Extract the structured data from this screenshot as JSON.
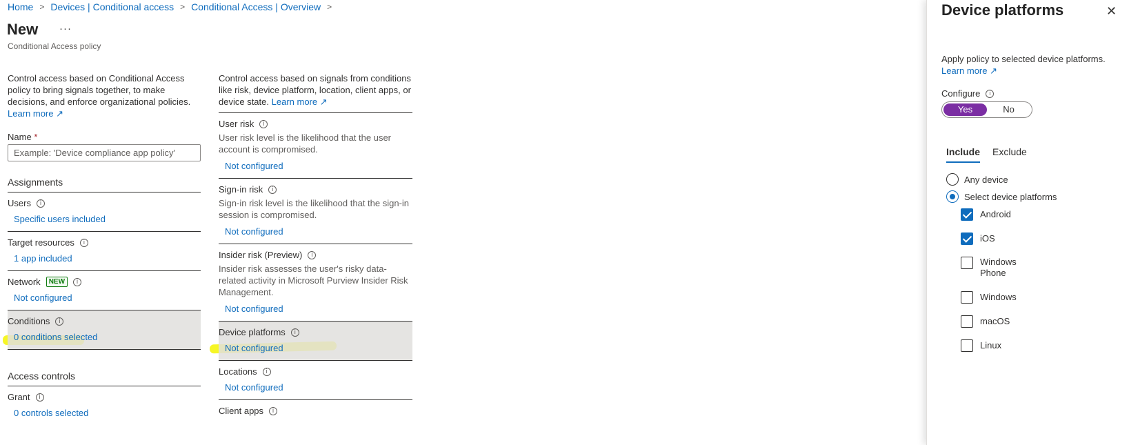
{
  "breadcrumb": [
    "Home",
    "Devices | Conditional access",
    "Conditional Access | Overview"
  ],
  "page": {
    "title": "New",
    "subtitle": "Conditional Access policy"
  },
  "left": {
    "description": "Control access based on Conditional Access policy to bring signals together, to make decisions, and enforce organizational policies.",
    "learn_more": "Learn more",
    "name_label": "Name",
    "name_required": "*",
    "name_placeholder": "Example: 'Device compliance app policy'",
    "assignments_header": "Assignments",
    "users": {
      "label": "Users",
      "value": "Specific users included"
    },
    "target_resources": {
      "label": "Target resources",
      "value": "1 app included"
    },
    "network": {
      "label": "Network",
      "badge": "NEW",
      "value": "Not configured"
    },
    "conditions": {
      "label": "Conditions",
      "value": "0 conditions selected"
    },
    "access_controls_header": "Access controls",
    "grant": {
      "label": "Grant",
      "value": "0 controls selected"
    }
  },
  "conditions": {
    "description": "Control access based on signals from conditions like risk, device platform, location, client apps, or device state.",
    "learn_more": "Learn more",
    "user_risk": {
      "label": "User risk",
      "desc": "User risk level is the likelihood that the user account is compromised.",
      "value": "Not configured"
    },
    "signin_risk": {
      "label": "Sign-in risk",
      "desc": "Sign-in risk level is the likelihood that the sign-in session is compromised.",
      "value": "Not configured"
    },
    "insider_risk": {
      "label": "Insider risk (Preview)",
      "desc": "Insider risk assesses the user's risky data-related activity in Microsoft Purview Insider Risk Management.",
      "value": "Not configured"
    },
    "device_platforms": {
      "label": "Device platforms",
      "value": "Not configured"
    },
    "locations": {
      "label": "Locations",
      "value": "Not configured"
    },
    "client_apps": {
      "label": "Client apps"
    }
  },
  "panel": {
    "title": "Device platforms",
    "description": "Apply policy to selected device platforms.",
    "learn_more": "Learn more",
    "configure_label": "Configure",
    "toggle_yes": "Yes",
    "toggle_no": "No",
    "toggle_selected": "Yes",
    "tabs": [
      "Include",
      "Exclude"
    ],
    "active_tab": "Include",
    "radio_any": "Any device",
    "radio_select": "Select device platforms",
    "radio_selected": "Select device platforms",
    "platforms": [
      {
        "label": "Android",
        "checked": true
      },
      {
        "label": "iOS",
        "checked": true
      },
      {
        "label": "Windows Phone",
        "checked": false
      },
      {
        "label": "Windows",
        "checked": false
      },
      {
        "label": "macOS",
        "checked": false
      },
      {
        "label": "Linux",
        "checked": false
      }
    ]
  },
  "colors": {
    "link": "#0f6cbd",
    "toggle_on": "#7b2ea3",
    "selected_row": "#e1dfdd",
    "highlight": "#f4f400"
  },
  "icons": {
    "info": "info-icon",
    "external": "external-link-icon",
    "close": "close-icon",
    "more": "more-icon",
    "chevron": "chevron-right-icon"
  }
}
